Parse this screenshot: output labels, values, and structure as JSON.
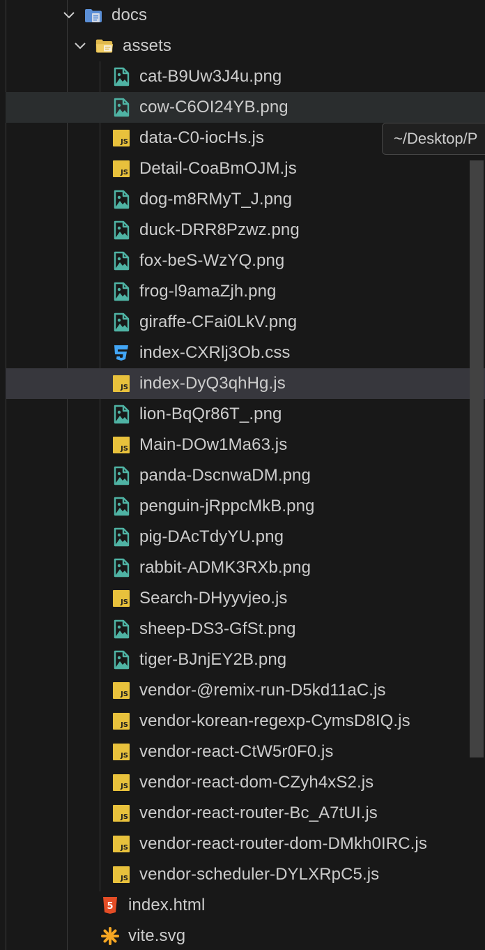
{
  "explorer": {
    "folders": {
      "docs": {
        "label": "docs",
        "expanded": true
      },
      "assets": {
        "label": "assets",
        "expanded": true
      }
    },
    "asset_files": [
      {
        "name": "cat-B9Uw3J4u.png",
        "type": "png"
      },
      {
        "name": "cow-C6OI24YB.png",
        "type": "png"
      },
      {
        "name": "data-C0-iocHs.js",
        "type": "js"
      },
      {
        "name": "Detail-CoaBmOJM.js",
        "type": "js"
      },
      {
        "name": "dog-m8RMyT_J.png",
        "type": "png"
      },
      {
        "name": "duck-DRR8Pzwz.png",
        "type": "png"
      },
      {
        "name": "fox-beS-WzYQ.png",
        "type": "png"
      },
      {
        "name": "frog-l9amaZjh.png",
        "type": "png"
      },
      {
        "name": "giraffe-CFai0LkV.png",
        "type": "png"
      },
      {
        "name": "index-CXRlj3Ob.css",
        "type": "css"
      },
      {
        "name": "index-DyQ3qhHg.js",
        "type": "js"
      },
      {
        "name": "lion-BqQr86T_.png",
        "type": "png"
      },
      {
        "name": "Main-DOw1Ma63.js",
        "type": "js"
      },
      {
        "name": "panda-DscnwaDM.png",
        "type": "png"
      },
      {
        "name": "penguin-jRppcMkB.png",
        "type": "png"
      },
      {
        "name": "pig-DAcTdyYU.png",
        "type": "png"
      },
      {
        "name": "rabbit-ADMK3RXb.png",
        "type": "png"
      },
      {
        "name": "Search-DHyyvjeo.js",
        "type": "js"
      },
      {
        "name": "sheep-DS3-GfSt.png",
        "type": "png"
      },
      {
        "name": "tiger-BJnjEY2B.png",
        "type": "png"
      },
      {
        "name": "vendor-@remix-run-D5kd11aC.js",
        "type": "js"
      },
      {
        "name": "vendor-korean-regexp-CymsD8IQ.js",
        "type": "js"
      },
      {
        "name": "vendor-react-CtW5r0F0.js",
        "type": "js"
      },
      {
        "name": "vendor-react-dom-CZyh4xS2.js",
        "type": "js"
      },
      {
        "name": "vendor-react-router-Bc_A7tUI.js",
        "type": "js"
      },
      {
        "name": "vendor-react-router-dom-DMkh0IRC.js",
        "type": "js"
      },
      {
        "name": "vendor-scheduler-DYLXRpC5.js",
        "type": "js"
      }
    ],
    "docs_files": [
      {
        "name": "index.html",
        "type": "html"
      },
      {
        "name": "vite.svg",
        "type": "svg"
      }
    ],
    "hovered_file": "cow-C6OI24YB.png",
    "selected_file": "index-DyQ3qhHg.js",
    "tooltip": "~/Desktop/P",
    "js_badge": "JS"
  },
  "colors": {
    "background": "#181818",
    "text": "#cccccc",
    "js": "#e8c13c",
    "image": "#4fb3a4",
    "css": "#42a5f5",
    "html": "#e44d26",
    "svg": "#f5a623",
    "folder": "#5b8fd6",
    "assets_folder": "#e0b94c",
    "hover": "#2a2d2e",
    "selected": "#37373d"
  },
  "icons": {
    "png": "image-file-icon",
    "js": "js-file-icon",
    "css": "css-file-icon",
    "html": "html-file-icon",
    "svg": "svg-file-icon",
    "chevron": "chevron-down-icon"
  }
}
